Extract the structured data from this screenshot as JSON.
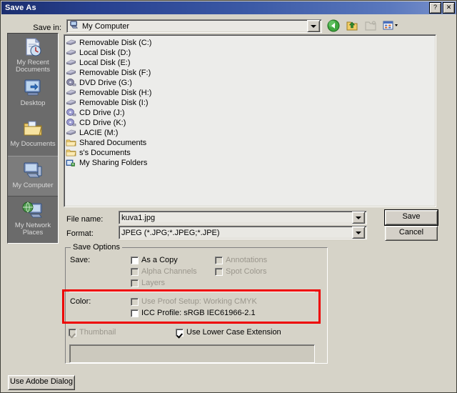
{
  "window": {
    "title": "Save As",
    "help_button": "?",
    "close_button": "✕"
  },
  "savein": {
    "label": "Save in:",
    "value": "My Computer",
    "icon": "my-computer-icon"
  },
  "toolbar": {
    "items": [
      {
        "name": "back-icon",
        "title": "Back",
        "enabled": true
      },
      {
        "name": "up-one-level-icon",
        "title": "Up One Level",
        "enabled": true
      },
      {
        "name": "new-folder-icon",
        "title": "Create New Folder",
        "enabled": false
      },
      {
        "name": "views-icon",
        "title": "Views",
        "enabled": true
      }
    ]
  },
  "places": [
    {
      "label": "My Recent\nDocuments",
      "icon": "recent-documents-icon",
      "selected": false
    },
    {
      "label": "Desktop",
      "icon": "desktop-icon",
      "selected": false
    },
    {
      "label": "My Documents",
      "icon": "my-documents-icon",
      "selected": false
    },
    {
      "label": "My Computer",
      "icon": "my-computer-icon",
      "selected": true
    },
    {
      "label": "My Network\nPlaces",
      "icon": "network-places-icon",
      "selected": false
    }
  ],
  "filelist": [
    {
      "label": "Removable Disk (C:)",
      "icon": "drive-icon"
    },
    {
      "label": "Local Disk (D:)",
      "icon": "drive-icon"
    },
    {
      "label": "Local Disk (E:)",
      "icon": "drive-icon"
    },
    {
      "label": "Removable Disk (F:)",
      "icon": "drive-icon"
    },
    {
      "label": "DVD Drive (G:)",
      "icon": "dvd-drive-icon"
    },
    {
      "label": "Removable Disk (H:)",
      "icon": "drive-icon"
    },
    {
      "label": "Removable Disk (I:)",
      "icon": "drive-icon"
    },
    {
      "label": "CD Drive (J:)",
      "icon": "cd-drive-icon"
    },
    {
      "label": "CD Drive (K:)",
      "icon": "cd-drive-icon"
    },
    {
      "label": "LACIE (M:)",
      "icon": "drive-icon"
    },
    {
      "label": "Shared Documents",
      "icon": "folder-icon"
    },
    {
      "label": "s's Documents",
      "icon": "folder-icon"
    },
    {
      "label": "My Sharing Folders",
      "icon": "shared-folder-icon"
    }
  ],
  "filename": {
    "label": "File name:",
    "value": "kuva1.jpg"
  },
  "format": {
    "label": "Format:",
    "value": "JPEG (*.JPG;*.JPEG;*.JPE)"
  },
  "buttons": {
    "save": "Save",
    "cancel": "Cancel",
    "use_adobe_dialog": "Use Adobe Dialog"
  },
  "save_options": {
    "group_title": "Save Options",
    "save_label": "Save:",
    "color_label": "Color:",
    "checkboxes": {
      "as_a_copy": {
        "label": "As a Copy",
        "checked": false,
        "enabled": true
      },
      "alpha_channels": {
        "label": "Alpha Channels",
        "checked": false,
        "enabled": false
      },
      "layers": {
        "label": "Layers",
        "checked": false,
        "enabled": false
      },
      "annotations": {
        "label": "Annotations",
        "checked": false,
        "enabled": false
      },
      "spot_colors": {
        "label": "Spot Colors",
        "checked": false,
        "enabled": false
      },
      "use_proof_setup": {
        "label": "Use Proof Setup:  Working CMYK",
        "checked": false,
        "enabled": false
      },
      "icc_profile": {
        "label": "ICC Profile:  sRGB IEC61966-2.1",
        "checked": false,
        "enabled": true
      },
      "thumbnail": {
        "label": "Thumbnail",
        "checked": true,
        "enabled": false
      },
      "lowercase_extension": {
        "label": "Use Lower Case Extension",
        "checked": true,
        "enabled": true
      }
    }
  },
  "annotation": {
    "highlight_color": "#ee0000",
    "target": "color-options-row"
  },
  "colors": {
    "titlebar_start": "#1b2e6e",
    "titlebar_end": "#7b93cc",
    "dialog_bg": "#d6d3c8",
    "list_bg": "#ececea",
    "placesbar_bg": "#6b6b6b",
    "disabled_text": "#9a968c"
  }
}
